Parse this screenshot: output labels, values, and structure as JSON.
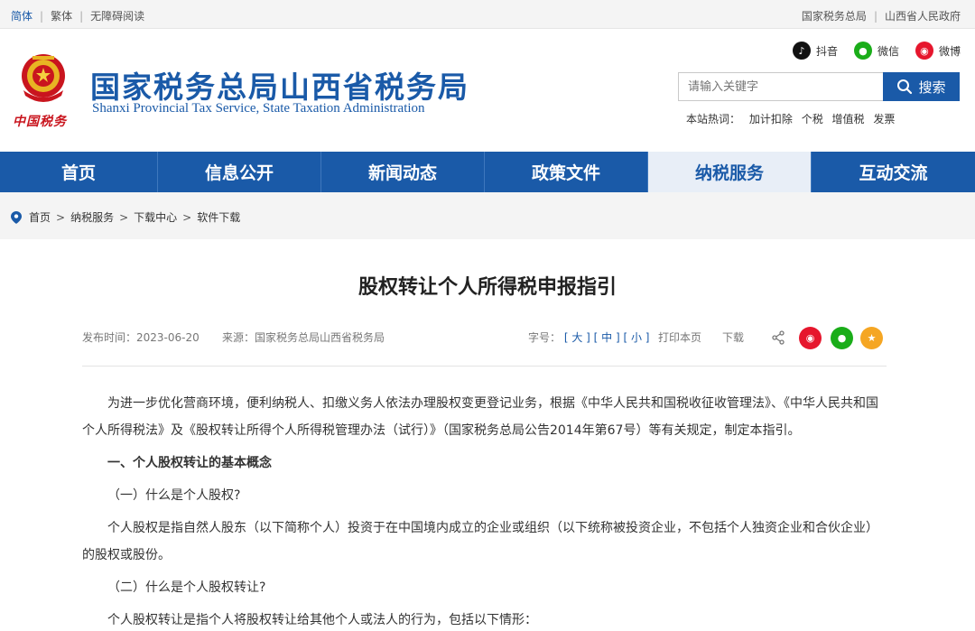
{
  "topbar": {
    "left": [
      "简体",
      "繁体",
      "无障碍阅读"
    ],
    "right": [
      "国家税务总局",
      "山西省人民政府"
    ]
  },
  "header": {
    "seal_text": "中国税务",
    "title": "国家税务总局山西省税务局",
    "subtitle": "Shanxi Provincial Tax Service, State Taxation Administration",
    "social": [
      {
        "label": "抖音",
        "icon": "douyin-icon",
        "color": "#111111"
      },
      {
        "label": "微信",
        "icon": "wechat-icon",
        "color": "#1aad19"
      },
      {
        "label": "微博",
        "icon": "weibo-icon",
        "color": "#e6162d"
      }
    ],
    "search": {
      "placeholder": "请输入关键字",
      "button": "搜索"
    },
    "hotwords": {
      "label": "本站热词：",
      "words": [
        "加计扣除",
        "个税",
        "增值税",
        "发票"
      ]
    }
  },
  "nav": {
    "items": [
      "首页",
      "信息公开",
      "新闻动态",
      "政策文件",
      "纳税服务",
      "互动交流"
    ],
    "active": "纳税服务"
  },
  "breadcrumb": [
    "首页",
    "纳税服务",
    "下载中心",
    "软件下载"
  ],
  "article": {
    "title": "股权转让个人所得税申报指引",
    "date": "发布时间：2023-06-20",
    "source": "来源：国家税务总局山西省税务局",
    "font_label": "字号：",
    "font_large": "[ 大 ]",
    "font_medium": "[ 中 ]",
    "font_small": "[ 小 ]",
    "print": "打印本页",
    "download": "下载",
    "paragraphs": [
      "为进一步优化营商环境，便利纳税人、扣缴义务人依法办理股权变更登记业务，根据《中华人民共和国税收征收管理法》、《中华人民共和国个人所得税法》及《股权转让所得个人所得税管理办法（试行）》（国家税务总局公告2014年第67号）等有关规定，制定本指引。",
      "一、个人股权转让的基本概念",
      "（一）什么是个人股权?",
      "个人股权是指自然人股东（以下简称个人）投资于在中国境内成立的企业或组织（以下统称被投资企业，不包括个人独资企业和合伙企业）的股权或股份。",
      "（二）什么是个人股权转让?",
      "个人股权转让是指个人将股权转让给其他个人或法人的行为，包括以下情形："
    ]
  },
  "colors": {
    "brand": "#1a5aa8",
    "seal": "#c9151e"
  }
}
